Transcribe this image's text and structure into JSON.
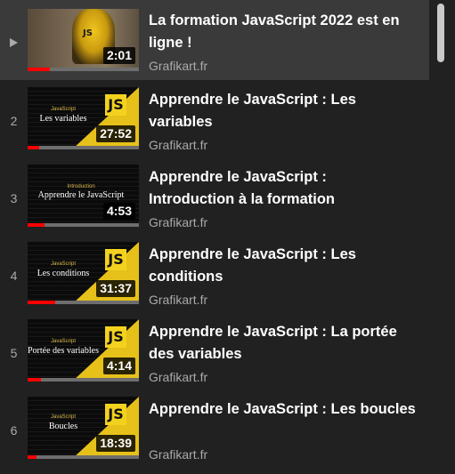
{
  "playlist": {
    "items": [
      {
        "index": "",
        "playing": true,
        "thumb_text_small": "",
        "thumb_text": "",
        "thumb_badge": "JS",
        "duration": "2:01",
        "progress": 0.2,
        "title": "La formation JavaScript 2022 est en ligne !",
        "channel": "Grafikart.fr"
      },
      {
        "index": "2",
        "playing": false,
        "thumb_text_small": "JavaScript",
        "thumb_text": "Les variables",
        "thumb_badge": "JS",
        "duration": "27:52",
        "progress": 0.1,
        "title": "Apprendre le JavaScript : Les variables",
        "channel": "Grafikart.fr"
      },
      {
        "index": "3",
        "playing": false,
        "thumb_text_small": "Introduction",
        "thumb_text": "Apprendre le JavaScript",
        "thumb_badge": "",
        "duration": "4:53",
        "progress": 0.15,
        "title": "Apprendre le JavaScript : Introduction à la formation",
        "channel": "Grafikart.fr"
      },
      {
        "index": "4",
        "playing": false,
        "thumb_text_small": "JavaScript",
        "thumb_text": "Les conditions",
        "thumb_badge": "JS",
        "duration": "31:37",
        "progress": 0.25,
        "title": "Apprendre le JavaScript : Les conditions",
        "channel": "Grafikart.fr"
      },
      {
        "index": "5",
        "playing": false,
        "thumb_text_small": "JavaScript",
        "thumb_text": "Portée des variables",
        "thumb_badge": "JS",
        "duration": "4:14",
        "progress": 0.12,
        "title": "Apprendre le JavaScript : La portée des variables",
        "channel": "Grafikart.fr"
      },
      {
        "index": "6",
        "playing": false,
        "thumb_text_small": "JavaScript",
        "thumb_text": "Boucles",
        "thumb_badge": "JS",
        "duration": "18:39",
        "progress": 0.08,
        "title": "Apprendre le JavaScript : Les boucles",
        "channel": "Grafikart.fr"
      }
    ]
  },
  "colors": {
    "background": "#212121",
    "active_row": "#3a3a3a",
    "progress_fill": "#ff0000",
    "js_yellow": "#f3d21f"
  }
}
